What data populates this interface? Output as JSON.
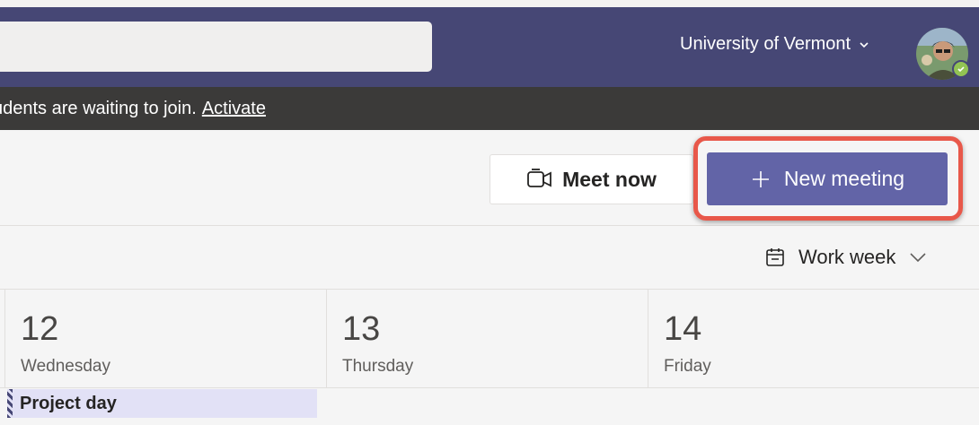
{
  "header": {
    "search_placeholder": "",
    "org_name": "University of Vermont",
    "org_icon": "chevron-down-icon",
    "avatar_icon": "user-avatar",
    "presence_status": "available"
  },
  "banner": {
    "message": "udents are waiting to join.",
    "link_label": "Activate"
  },
  "toolbar": {
    "meet_now_label": "Meet now",
    "meet_now_icon": "video-camera-icon",
    "new_meeting_label": "New meeting",
    "new_meeting_icon": "plus-icon",
    "highlight_color": "#e8584a",
    "accent_color": "#6264a7"
  },
  "view": {
    "label": "Work week",
    "icon": "calendar-icon"
  },
  "days": [
    {
      "num": "12",
      "name": "Wednesday"
    },
    {
      "num": "13",
      "name": "Thursday"
    },
    {
      "num": "14",
      "name": "Friday"
    }
  ],
  "events": [
    {
      "title": "Project day"
    }
  ]
}
